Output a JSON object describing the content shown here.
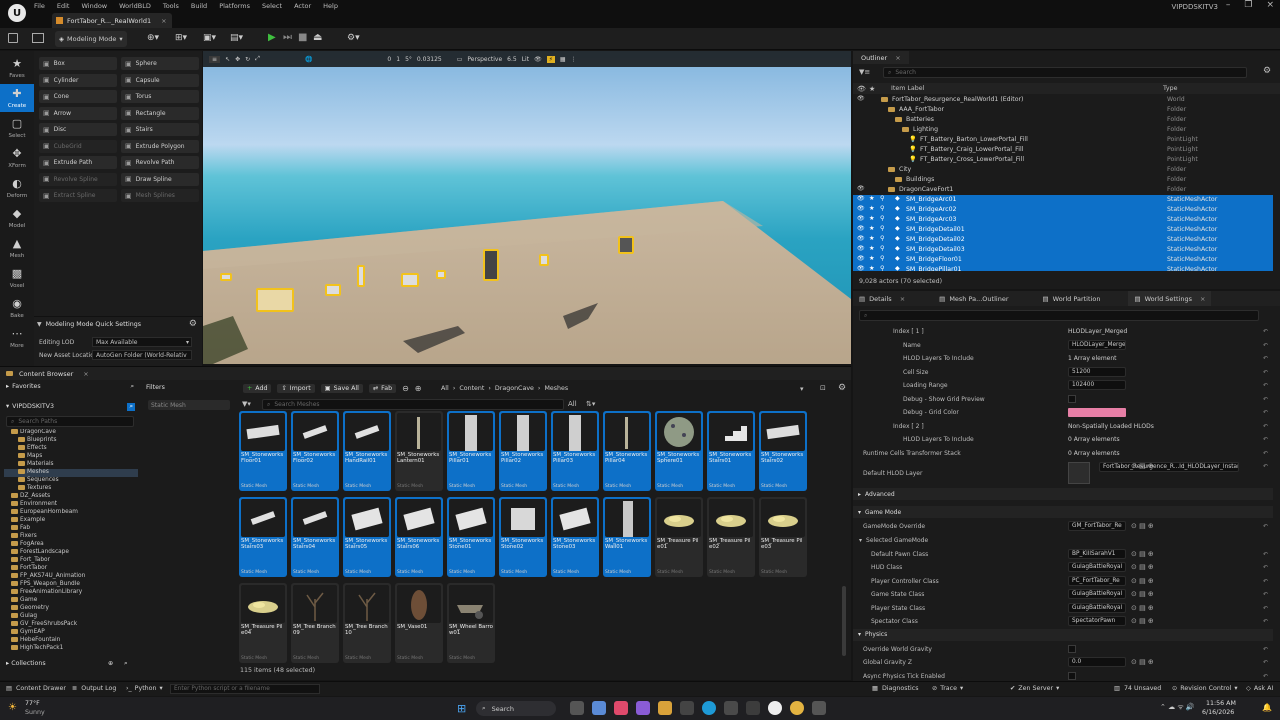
{
  "menu": [
    "File",
    "Edit",
    "Window",
    "WorldBLD",
    "Tools",
    "Build",
    "Platforms",
    "Select",
    "Actor",
    "Help"
  ],
  "doc_tab": "FortTabor_R..._RealWorld1",
  "project_name": "VIPDDSKITV3",
  "toolbar": {
    "mode": "Modeling Mode"
  },
  "modes": [
    {
      "label": "Faves",
      "icon": "star-icon"
    },
    {
      "label": "Create",
      "icon": "create-icon",
      "active": true
    },
    {
      "label": "Select",
      "icon": "select-icon"
    },
    {
      "label": "XForm",
      "icon": "xform-icon"
    },
    {
      "label": "Deform",
      "icon": "deform-icon"
    },
    {
      "label": "Model",
      "icon": "model-icon"
    },
    {
      "label": "Mesh",
      "icon": "mesh-icon"
    },
    {
      "label": "Voxel",
      "icon": "voxel-icon"
    },
    {
      "label": "Bake",
      "icon": "bake-icon"
    },
    {
      "label": "More",
      "icon": "more-icon"
    }
  ],
  "tools": [
    {
      "label": "Box",
      "dis": false
    },
    {
      "label": "Sphere",
      "dis": false
    },
    {
      "label": "Cylinder",
      "dis": false
    },
    {
      "label": "Capsule",
      "dis": false
    },
    {
      "label": "Cone",
      "dis": false
    },
    {
      "label": "Torus",
      "dis": false
    },
    {
      "label": "Arrow",
      "dis": false
    },
    {
      "label": "Rectangle",
      "dis": false
    },
    {
      "label": "Disc",
      "dis": false
    },
    {
      "label": "Stairs",
      "dis": false
    },
    {
      "label": "CubeGrid",
      "dis": true
    },
    {
      "label": "Extrude Polygon",
      "dis": false
    },
    {
      "label": "Extrude Path",
      "dis": false
    },
    {
      "label": "Revolve Path",
      "dis": false
    },
    {
      "label": "Revolve Spline",
      "dis": true
    },
    {
      "label": "Draw Spline",
      "dis": false
    },
    {
      "label": "Extract Spline",
      "dis": true
    },
    {
      "label": "Mesh Splines",
      "dis": true
    }
  ],
  "quick_settings": {
    "title": "Modeling Mode Quick Settings",
    "editing_lod_label": "Editing LOD",
    "editing_lod_value": "Max Available",
    "new_asset_label": "New Asset Location",
    "new_asset_value": "AutoGen Folder (World-Relativ"
  },
  "viewport": {
    "perspective": "Perspective",
    "lit": "Lit",
    "fov": "6.5",
    "snap1": "0",
    "snap2": "1",
    "angle": "5°",
    "scale": "0.03125"
  },
  "outliner": {
    "tab": "Outliner",
    "search_placeholder": "Search",
    "col_label": "Item Label",
    "col_type": "Type",
    "rows": [
      {
        "indent": 4,
        "label": "FortTabor_Resurgence_RealWorld1 (Editor)",
        "type": "World",
        "sel": false
      },
      {
        "indent": 5,
        "label": "AAA_FortTabor",
        "type": "Folder",
        "sel": false
      },
      {
        "indent": 6,
        "label": "Batteries",
        "type": "Folder",
        "sel": false
      },
      {
        "indent": 7,
        "label": "Lighting",
        "type": "Folder",
        "sel": false
      },
      {
        "indent": 8,
        "label": "FT_Battery_Barton_LowerPortal_Fill",
        "type": "PointLight",
        "sel": false
      },
      {
        "indent": 8,
        "label": "FT_Battery_Craig_LowerPortal_Fill",
        "type": "PointLight",
        "sel": false
      },
      {
        "indent": 8,
        "label": "FT_Battery_Cross_LowerPortal_Fill",
        "type": "PointLight",
        "sel": false
      },
      {
        "indent": 5,
        "label": "City",
        "type": "Folder",
        "sel": false
      },
      {
        "indent": 6,
        "label": "Buildings",
        "type": "Folder",
        "sel": false
      },
      {
        "indent": 5,
        "label": "DragonCaveFort1",
        "type": "Folder",
        "sel": false
      },
      {
        "indent": 6,
        "label": "SM_BridgeArc01",
        "type": "StaticMeshActor",
        "sel": true
      },
      {
        "indent": 6,
        "label": "SM_BridgeArc02",
        "type": "StaticMeshActor",
        "sel": true
      },
      {
        "indent": 6,
        "label": "SM_BridgeArc03",
        "type": "StaticMeshActor",
        "sel": true
      },
      {
        "indent": 6,
        "label": "SM_BridgeDetail01",
        "type": "StaticMeshActor",
        "sel": true
      },
      {
        "indent": 6,
        "label": "SM_BridgeDetail02",
        "type": "StaticMeshActor",
        "sel": true
      },
      {
        "indent": 6,
        "label": "SM_BridgeDetail03",
        "type": "StaticMeshActor",
        "sel": true
      },
      {
        "indent": 6,
        "label": "SM_BridgeFloor01",
        "type": "StaticMeshActor",
        "sel": true
      },
      {
        "indent": 6,
        "label": "SM_BridgePillar01",
        "type": "StaticMeshActor",
        "sel": true
      }
    ],
    "footer": "9,028 actors (70 selected)"
  },
  "detail_tabs": [
    "Details",
    "Mesh Pa...Outliner",
    "World Partition",
    "World Settings"
  ],
  "details_rows": [
    {
      "kind": "row",
      "indent": 40,
      "k": "Index [ 1 ]",
      "v": "HLODLayer_Merged",
      "field": false
    },
    {
      "kind": "row",
      "indent": 50,
      "k": "Name",
      "v": "HLODLayer_Merged",
      "field": true
    },
    {
      "kind": "row",
      "indent": 50,
      "k": "HLOD Layers To Include",
      "v": "1 Array element",
      "field": false
    },
    {
      "kind": "row",
      "indent": 50,
      "k": "Cell Size",
      "v": "51200",
      "field": true
    },
    {
      "kind": "row",
      "indent": 50,
      "k": "Loading Range",
      "v": "102400",
      "field": true
    },
    {
      "kind": "row",
      "indent": 50,
      "k": "Debug - Show Grid Preview",
      "v": "",
      "field": false
    },
    {
      "kind": "row",
      "indent": 50,
      "k": "Debug - Grid Color",
      "v": "",
      "field": false,
      "color": "#e77fa6"
    },
    {
      "kind": "row",
      "indent": 40,
      "k": "Index [ 2 ]",
      "v": "Non-Spatially Loaded HLODs",
      "field": false
    },
    {
      "kind": "row",
      "indent": 50,
      "k": "HLOD Layers To Include",
      "v": "0 Array elements",
      "field": false
    },
    {
      "kind": "row",
      "indent": 10,
      "k": "Runtime Cells Transformer Stack",
      "v": "0 Array elements",
      "field": false
    },
    {
      "kind": "row",
      "indent": 10,
      "k": "Default HLOD Layer",
      "v": "FortTabor_Resurgence_R...ld_HLODLayer_Instanced",
      "field": true
    },
    {
      "kind": "cat",
      "k": "Advanced"
    },
    {
      "kind": "cat",
      "k": "Game Mode"
    },
    {
      "kind": "row",
      "indent": 10,
      "k": "GameMode Override",
      "v": "GM_FortTabor_Re",
      "field": true
    },
    {
      "kind": "sub",
      "k": "Selected GameMode"
    },
    {
      "kind": "row",
      "indent": 18,
      "k": "Default Pawn Class",
      "v": "BP_KillSarahV1",
      "field": true
    },
    {
      "kind": "row",
      "indent": 18,
      "k": "HUD Class",
      "v": "GulagBattleRoyal",
      "field": true
    },
    {
      "kind": "row",
      "indent": 18,
      "k": "Player Controller Class",
      "v": "PC_FortTabor_Re",
      "field": true
    },
    {
      "kind": "row",
      "indent": 18,
      "k": "Game State Class",
      "v": "GulagBattleRoyal",
      "field": true
    },
    {
      "kind": "row",
      "indent": 18,
      "k": "Player State Class",
      "v": "GulagBattleRoyal",
      "field": true
    },
    {
      "kind": "row",
      "indent": 18,
      "k": "Spectator Class",
      "v": "SpectatorPawn",
      "field": true
    },
    {
      "kind": "cat",
      "k": "Physics"
    },
    {
      "kind": "row",
      "indent": 10,
      "k": "Override World Gravity",
      "v": "",
      "field": false
    },
    {
      "kind": "row",
      "indent": 10,
      "k": "Global Gravity Z",
      "v": "0.0",
      "field": true
    },
    {
      "kind": "row",
      "indent": 10,
      "k": "Async Physics Tick Enabled",
      "v": "",
      "field": false
    }
  ],
  "content_browser": {
    "tab": "Content Browser",
    "add": "Add",
    "import": "Import",
    "save_all": "Save All",
    "fab": "Fab",
    "breadcrumb": [
      "All",
      "Content",
      "DragonCave",
      "Meshes"
    ],
    "favorites": "Favorites",
    "filters": "Filters",
    "filter_chip": "Static Mesh",
    "project": "VIPDDSKITV3",
    "search_paths": "Search Paths",
    "search_meshes": "Search Meshes",
    "collections": "Collections",
    "status": "115 items (48 selected)",
    "tree": [
      {
        "indent": 1,
        "label": "DragonCave",
        "sel": false
      },
      {
        "indent": 2,
        "label": "Blueprints",
        "sel": false
      },
      {
        "indent": 2,
        "label": "Effects",
        "sel": false
      },
      {
        "indent": 2,
        "label": "Maps",
        "sel": false
      },
      {
        "indent": 2,
        "label": "Materials",
        "sel": false
      },
      {
        "indent": 2,
        "label": "Meshes",
        "sel": true
      },
      {
        "indent": 2,
        "label": "Sequences",
        "sel": false
      },
      {
        "indent": 2,
        "label": "Textures",
        "sel": false
      },
      {
        "indent": 1,
        "label": "DZ_Assets",
        "sel": false
      },
      {
        "indent": 1,
        "label": "Environment",
        "sel": false
      },
      {
        "indent": 1,
        "label": "EuropeanHornbeam",
        "sel": false
      },
      {
        "indent": 1,
        "label": "Example",
        "sel": false
      },
      {
        "indent": 1,
        "label": "Fab",
        "sel": false
      },
      {
        "indent": 1,
        "label": "Fixers",
        "sel": false
      },
      {
        "indent": 1,
        "label": "FogArea",
        "sel": false
      },
      {
        "indent": 1,
        "label": "ForestLandscape",
        "sel": false
      },
      {
        "indent": 1,
        "label": "Fort_Tabor",
        "sel": false
      },
      {
        "indent": 1,
        "label": "FortTabor",
        "sel": false
      },
      {
        "indent": 1,
        "label": "FP_AKS74U_Animation",
        "sel": false
      },
      {
        "indent": 1,
        "label": "FPS_Weapon_Bundle",
        "sel": false
      },
      {
        "indent": 1,
        "label": "FreeAnimationLibrary",
        "sel": false
      },
      {
        "indent": 1,
        "label": "Game",
        "sel": false
      },
      {
        "indent": 1,
        "label": "Geometry",
        "sel": false
      },
      {
        "indent": 1,
        "label": "Gulag",
        "sel": false
      },
      {
        "indent": 1,
        "label": "GV_FreeShrubsPack",
        "sel": false
      },
      {
        "indent": 1,
        "label": "GymEAP",
        "sel": false
      },
      {
        "indent": 1,
        "label": "HebeFountain",
        "sel": false
      },
      {
        "indent": 1,
        "label": "HighTechPack1",
        "sel": false
      }
    ],
    "assets": [
      {
        "name": "SM_Stoneworks Floor01",
        "cls": "Static Mesh",
        "sel": true,
        "thumb": "slab"
      },
      {
        "name": "SM_Stoneworks Floor02",
        "cls": "Static Mesh",
        "sel": true,
        "thumb": "plank"
      },
      {
        "name": "SM_Stoneworks HandRail01",
        "cls": "Static Mesh",
        "sel": true,
        "thumb": "plank"
      },
      {
        "name": "SM_Stoneworks Lantern01",
        "cls": "Static Mesh",
        "sel": false,
        "thumb": "pole"
      },
      {
        "name": "SM_Stoneworks Pillar01",
        "cls": "Static Mesh",
        "sel": true,
        "thumb": "pillar"
      },
      {
        "name": "SM_Stoneworks Pillar02",
        "cls": "Static Mesh",
        "sel": true,
        "thumb": "pillar"
      },
      {
        "name": "SM_Stoneworks Pillar03",
        "cls": "Static Mesh",
        "sel": true,
        "thumb": "pillar"
      },
      {
        "name": "SM_Stoneworks Pillar04",
        "cls": "Static Mesh",
        "sel": true,
        "thumb": "pole"
      },
      {
        "name": "SM_Stoneworks Sphere01",
        "cls": "Static Mesh",
        "sel": true,
        "thumb": "sphere"
      },
      {
        "name": "SM_Stoneworks Stairs01",
        "cls": "Static Mesh",
        "sel": true,
        "thumb": "stairs"
      },
      {
        "name": "SM_Stoneworks Stairs02",
        "cls": "Static Mesh",
        "sel": true,
        "thumb": "slab"
      },
      {
        "name": "SM_Stoneworks Stairs03",
        "cls": "Static Mesh",
        "sel": true,
        "thumb": "plank"
      },
      {
        "name": "SM_Stoneworks Stairs04",
        "cls": "Static Mesh",
        "sel": true,
        "thumb": "plank"
      },
      {
        "name": "SM_Stoneworks Stairs05",
        "cls": "Static Mesh",
        "sel": true,
        "thumb": "block"
      },
      {
        "name": "SM_Stoneworks Stairs06",
        "cls": "Static Mesh",
        "sel": true,
        "thumb": "block"
      },
      {
        "name": "SM_Stoneworks Stone01",
        "cls": "Static Mesh",
        "sel": true,
        "thumb": "block"
      },
      {
        "name": "SM_Stoneworks Stone02",
        "cls": "Static Mesh",
        "sel": true,
        "thumb": "cube"
      },
      {
        "name": "SM_Stoneworks Stone03",
        "cls": "Static Mesh",
        "sel": true,
        "thumb": "block"
      },
      {
        "name": "SM_Stoneworks Wall01",
        "cls": "Static Mesh",
        "sel": true,
        "thumb": "wall"
      },
      {
        "name": "SM_Treasure Pile01",
        "cls": "Static Mesh",
        "sel": false,
        "thumb": "gold"
      },
      {
        "name": "SM_Treasure Pile02",
        "cls": "Static Mesh",
        "sel": false,
        "thumb": "gold"
      },
      {
        "name": "SM_Treasure Pile03",
        "cls": "Static Mesh",
        "sel": false,
        "thumb": "gold"
      },
      {
        "name": "SM_Treasure Pile04",
        "cls": "Static Mesh",
        "sel": false,
        "thumb": "gold"
      },
      {
        "name": "SM_Tree Branch09",
        "cls": "Static Mesh",
        "sel": false,
        "thumb": "branch"
      },
      {
        "name": "SM_Tree Branch10",
        "cls": "Static Mesh",
        "sel": false,
        "thumb": "branch"
      },
      {
        "name": "SM_Vase01",
        "cls": "Static Mesh",
        "sel": false,
        "thumb": "vase"
      },
      {
        "name": "SM_Wheel Barrow01",
        "cls": "Static Mesh",
        "sel": false,
        "thumb": "barrow"
      }
    ]
  },
  "statusbar": {
    "content_drawer": "Content Drawer",
    "output_log": "Output Log",
    "python": "Python",
    "cmd_placeholder": "Enter Python script or a filename",
    "diagnostics": "Diagnostics",
    "trace": "Trace",
    "zen": "Zen Server",
    "unsaved": "74 Unsaved",
    "revision": "Revision Control",
    "ask": "Ask AI"
  },
  "taskbar": {
    "temp": "77°F",
    "weather": "Sunny",
    "search": "Search",
    "time": "11:56 AM",
    "date": "6/16/2026"
  }
}
